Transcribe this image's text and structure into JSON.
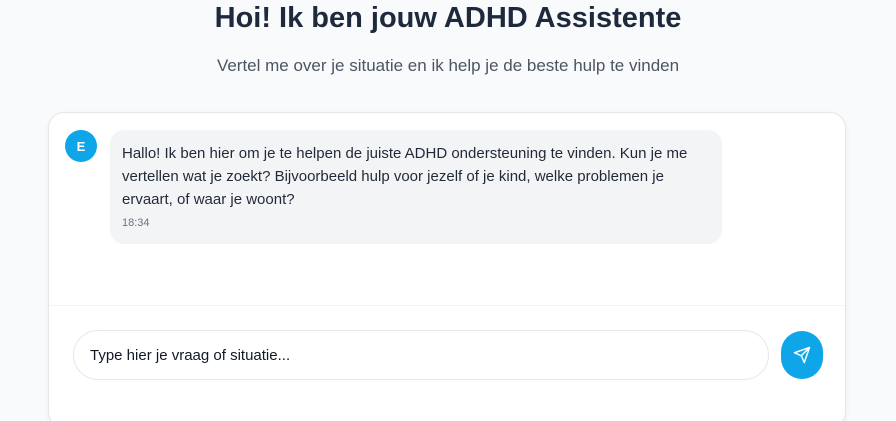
{
  "header": {
    "title": "Hoi! Ik ben jouw ADHD Assistente",
    "subtitle": "Vertel me over je situatie en ik help je de beste hulp te vinden"
  },
  "chat": {
    "messages": [
      {
        "sender_initial": "E",
        "text": "Hallo! Ik ben hier om je te helpen de juiste ADHD ondersteuning te vinden. Kun je me vertellen wat je zoekt? Bijvoorbeeld hulp voor jezelf of je kind, welke problemen je ervaart, of waar je woont?",
        "time": "18:34"
      }
    ],
    "input": {
      "placeholder": "Type hier je vraag of situatie...",
      "value": ""
    },
    "send_icon": "send-icon"
  },
  "colors": {
    "accent": "#0ea5e9",
    "bubble_bg": "#f3f4f6",
    "page_bg": "#f8fafc"
  }
}
